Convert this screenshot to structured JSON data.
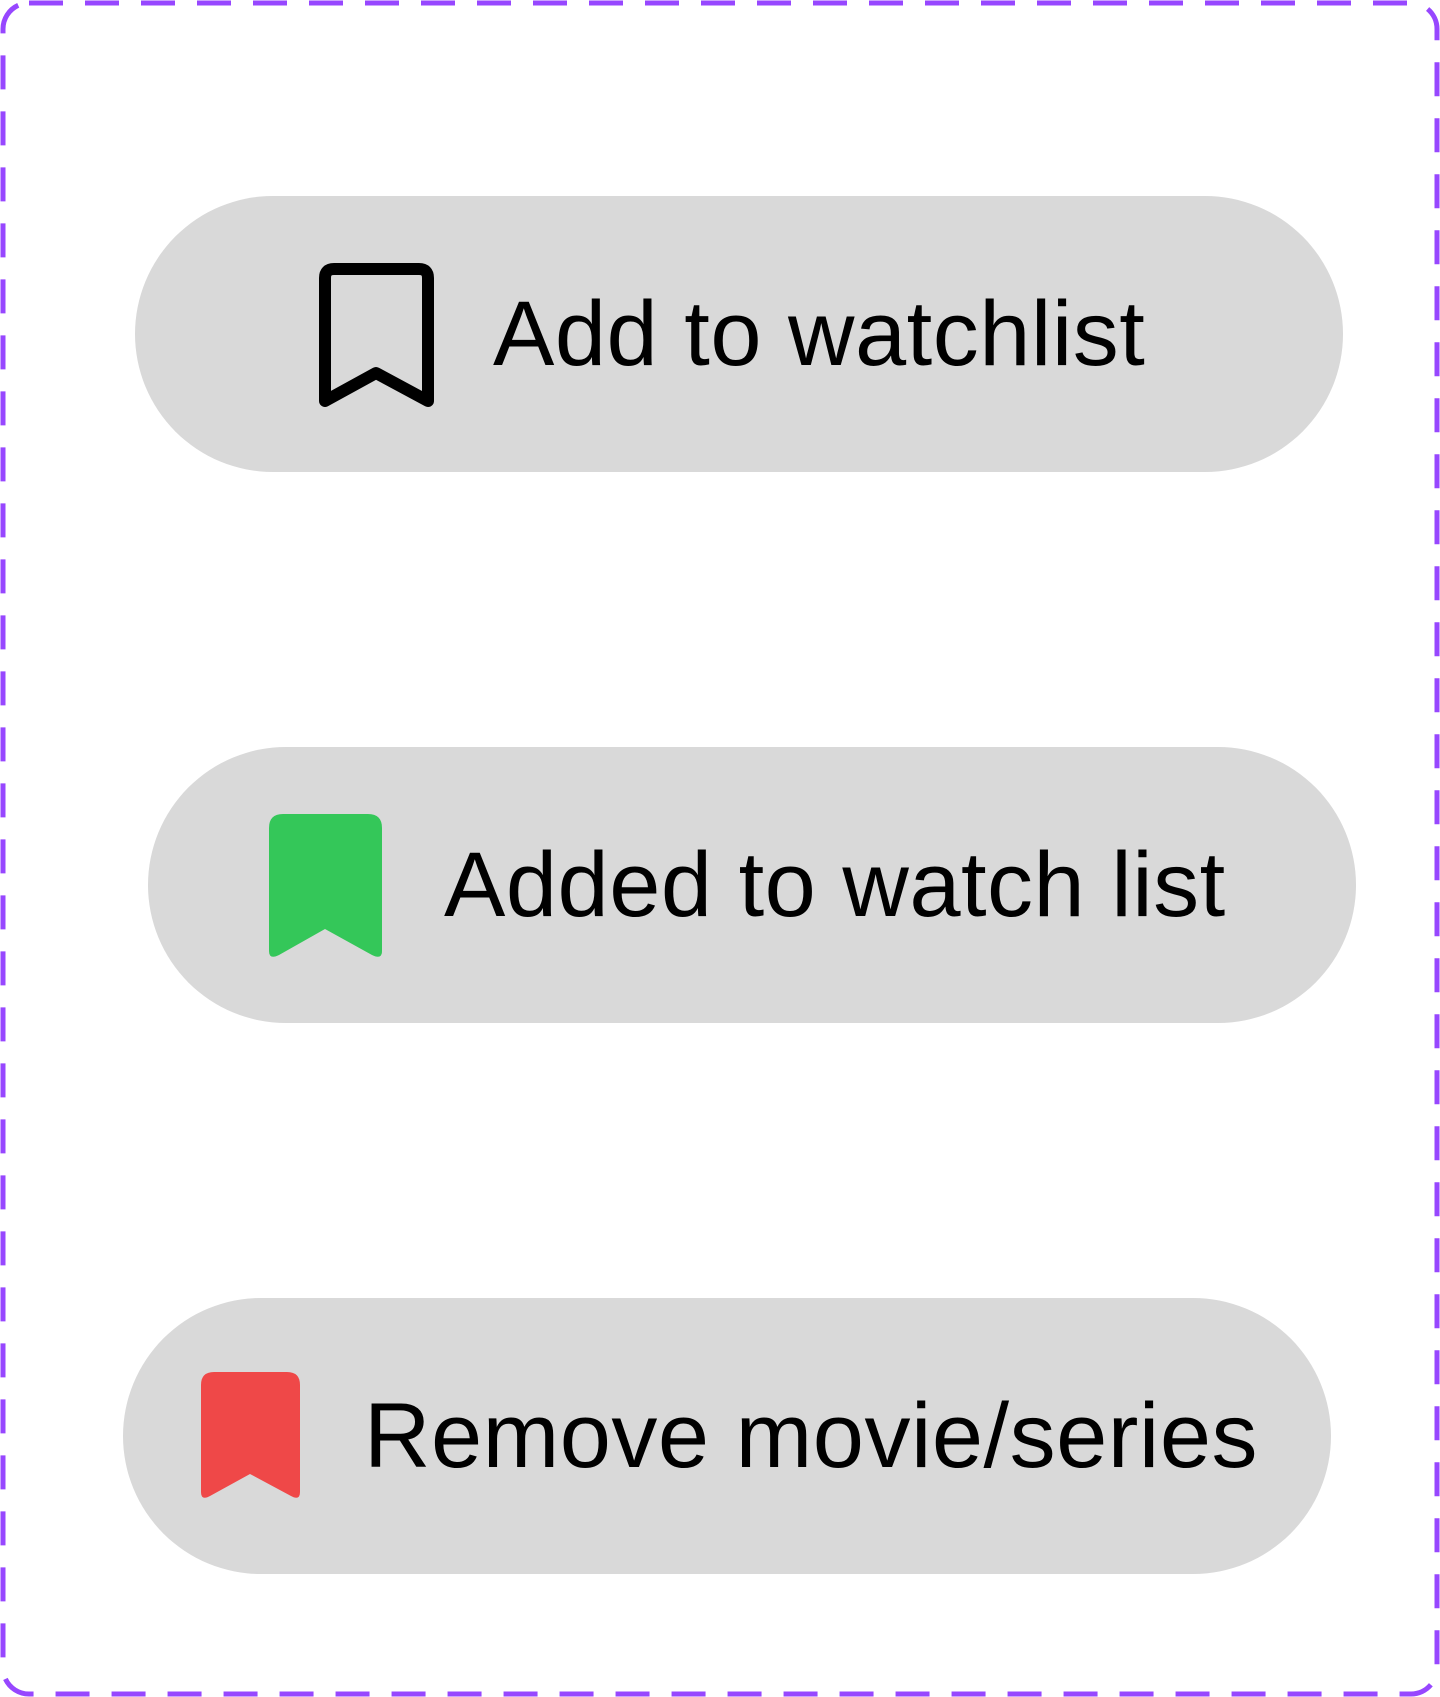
{
  "buttons": {
    "add": {
      "label": "Add to watchlist",
      "icon": "bookmark-outline-icon"
    },
    "added": {
      "label": "Added to watch list",
      "icon": "bookmark-filled-icon",
      "icon_color": "#34c759"
    },
    "remove": {
      "label": "Remove movie/series",
      "icon": "bookmark-filled-icon",
      "icon_color": "#ef4848"
    }
  },
  "colors": {
    "frame_border": "#9747ff",
    "button_background": "#d9d9d9",
    "text": "#000000"
  }
}
